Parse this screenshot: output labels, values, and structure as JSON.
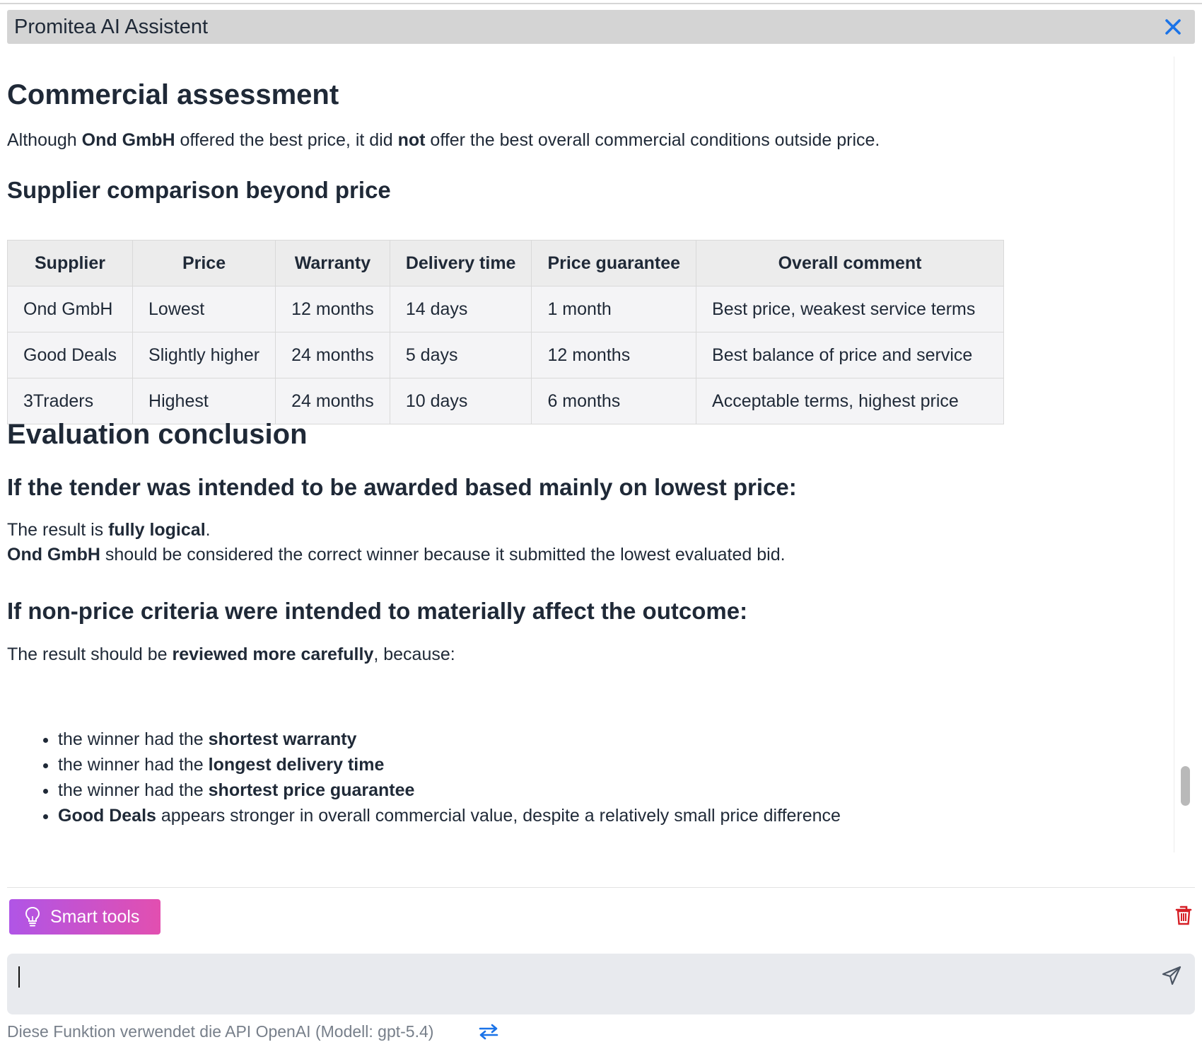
{
  "window": {
    "title": "Promitea AI Assistent"
  },
  "content": {
    "heading_commercial": "Commercial assessment",
    "intro": {
      "t1": "Although ",
      "b1": "Ond GmbH",
      "t2": " offered the best price, it did ",
      "b2": "not",
      "t3": " offer the best overall commercial conditions outside price."
    },
    "heading_comparison": "Supplier comparison beyond price",
    "table": {
      "headers": [
        "Supplier",
        "Price",
        "Warranty",
        "Delivery time",
        "Price guarantee",
        "Overall comment"
      ],
      "rows": [
        [
          "Ond GmbH",
          "Lowest",
          "12 months",
          "14 days",
          "1 month",
          "Best price, weakest service terms"
        ],
        [
          "Good Deals",
          "Slightly higher",
          "24 months",
          "5 days",
          "12 months",
          "Best balance of price and service"
        ],
        [
          "3Traders",
          "Highest",
          "24 months",
          "10 days",
          "6 months",
          "Acceptable terms, highest price"
        ]
      ]
    },
    "heading_conclusion": "Evaluation conclusion",
    "heading_lowest_price": "If the tender was intended to be awarded based mainly on lowest price:",
    "lowest_line1": {
      "t1": "The result is ",
      "b1": "fully logical",
      "t2": "."
    },
    "lowest_line2": {
      "b1": "Ond GmbH",
      "t1": " should be considered the correct winner because it submitted the lowest evaluated bid."
    },
    "heading_non_price": "If non-price criteria were intended to materially affect the outcome:",
    "review_line": {
      "t1": "The result should be ",
      "b1": "reviewed more carefully",
      "t2": ", because:"
    },
    "bullets": [
      {
        "pre": "the winner had the ",
        "bold": "shortest warranty",
        "post": ""
      },
      {
        "pre": "the winner had the ",
        "bold": "longest delivery time",
        "post": ""
      },
      {
        "pre": "the winner had the ",
        "bold": "shortest price guarantee",
        "post": ""
      },
      {
        "pre": "",
        "bold": "Good Deals",
        "post": " appears stronger in overall commercial value, despite a relatively small price difference"
      }
    ]
  },
  "toolbar": {
    "smart_tools_label": "Smart tools"
  },
  "input": {
    "value": ""
  },
  "footer": {
    "text": "Diese Funktion verwendet die API OpenAI (Modell: gpt-5.4)"
  },
  "icons": {
    "close": "close-icon",
    "bulb": "lightbulb-icon",
    "trash": "trash-icon",
    "send": "send-icon",
    "swap": "swap-arrows-icon"
  },
  "colors": {
    "accent_blue": "#1a73e8",
    "title_bar_bg": "#d4d4d4",
    "smart_tools_gradient_start": "#b055e6",
    "smart_tools_gradient_end": "#e24fb0",
    "delete_red": "#d61f26",
    "input_bg": "#e8eaee"
  }
}
